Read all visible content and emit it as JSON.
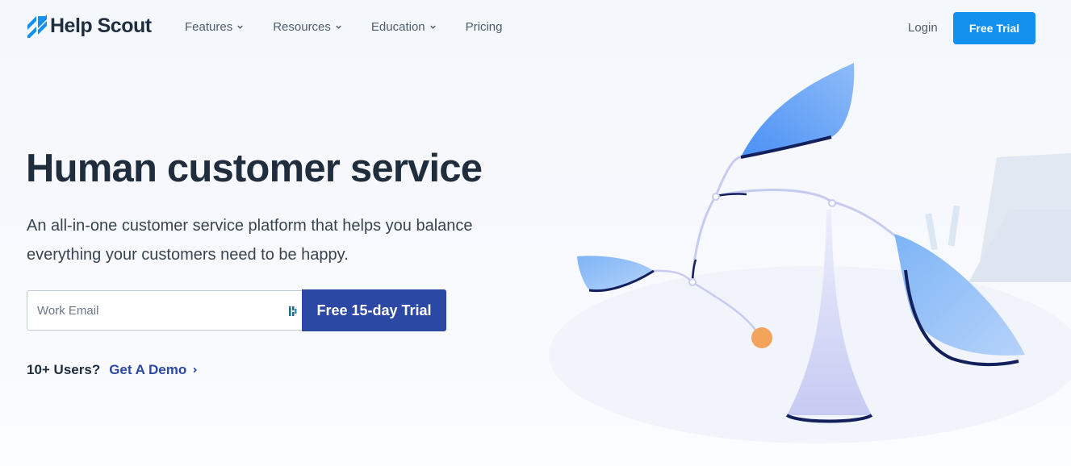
{
  "brand": {
    "name": "Help Scout"
  },
  "nav": {
    "items": [
      {
        "label": "Features",
        "has_dropdown": true
      },
      {
        "label": "Resources",
        "has_dropdown": true
      },
      {
        "label": "Education",
        "has_dropdown": true
      },
      {
        "label": "Pricing",
        "has_dropdown": false
      }
    ],
    "login_label": "Login",
    "trial_label": "Free Trial"
  },
  "hero": {
    "title": "Human customer service",
    "subtitle": "An all-in-one customer service platform that helps you balance everything your customers need to be happy.",
    "email_placeholder": "Work Email",
    "email_value": "",
    "submit_label": "Free 15-day Trial",
    "demo_question": "10+ Users?",
    "demo_link": "Get A Demo"
  },
  "colors": {
    "primary_blue": "#1292ee",
    "cta_blue": "#2a48a4",
    "heading": "#1f2d3d",
    "orange_accent": "#f2a45c"
  },
  "icons": [
    "helpscout-logo-icon",
    "chevron-down-icon",
    "password-manager-icon",
    "chevron-right-icon"
  ]
}
